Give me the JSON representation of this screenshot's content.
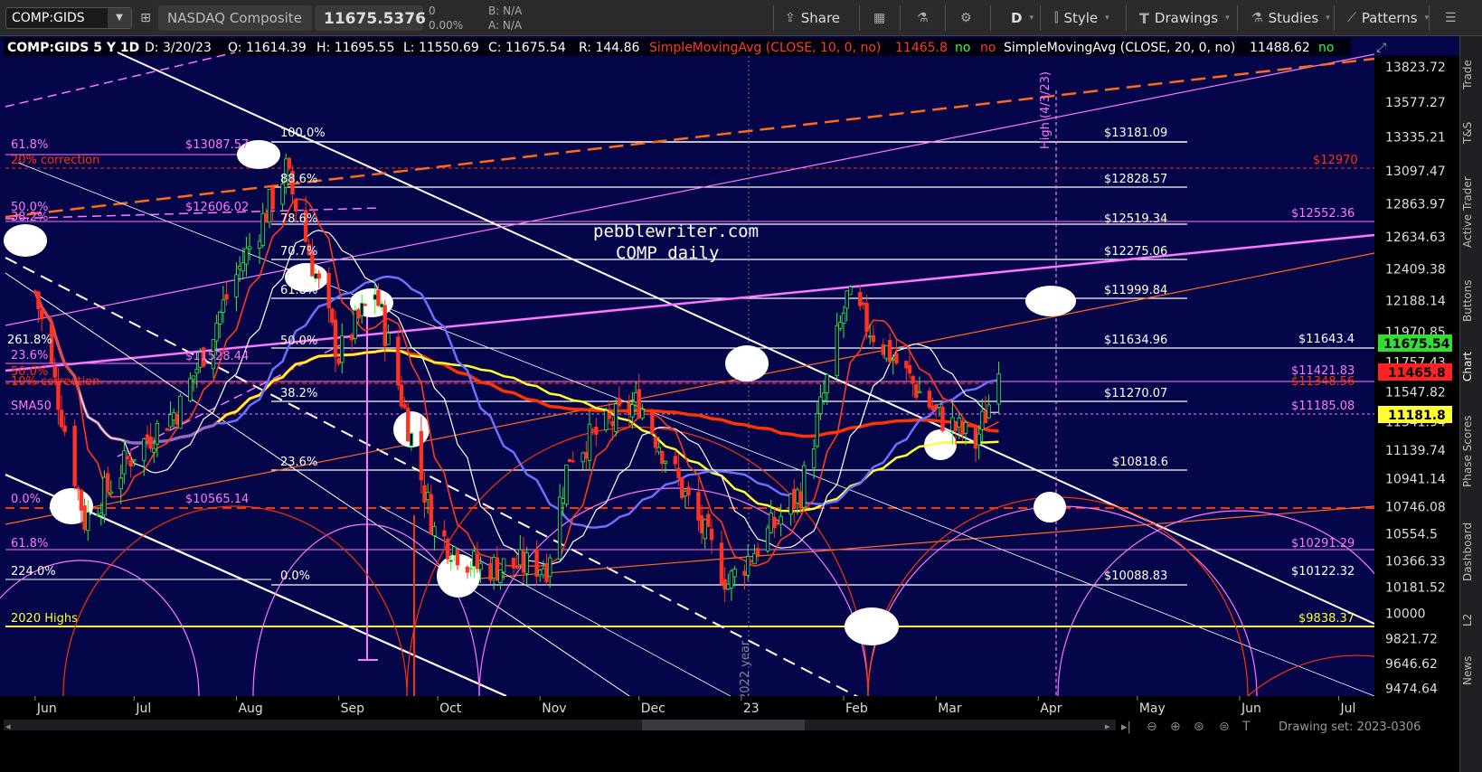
{
  "toolbar": {
    "symbol": "COMP:GIDS",
    "description": "NASDAQ Composite",
    "last_price": "11675.5376",
    "change": "0",
    "change_pct": "0.00%",
    "bid": "B: N/A",
    "ask": "A: N/A",
    "share_label": "Share",
    "period_label": "D",
    "style_label": "Style",
    "drawings_label": "Drawings",
    "studies_label": "Studies",
    "patterns_label": "Patterns"
  },
  "header": {
    "title": "COMP:GIDS 5 Y 1D",
    "date": "D: 3/20/23",
    "open": "O: 11614.39",
    "high": "H: 11695.55",
    "low": "L: 11550.69",
    "close": "C: 11675.54",
    "range": "R: 144.86",
    "sma10_label": "SimpleMovingAvg (CLOSE, 10, 0, no)",
    "sma10_value": "11465.8",
    "no1": "no",
    "no2": "no",
    "sma20_label": "SimpleMovingAvg (CLOSE, 20, 0, no)",
    "sma20_value": "11488.62",
    "no3": "no"
  },
  "watermark": {
    "line1": "pebblewriter.com",
    "line2": "COMP daily"
  },
  "annotations": {
    "high_marker": "High (4/3/23)",
    "year_marker": "2022 year",
    "left": [
      "61.8%",
      "20% correction",
      "50.0%",
      "38.2%",
      "261.8%",
      "23.6%",
      "50.0%",
      "10% correction",
      "SMA50",
      "0.0%",
      "61.8%",
      "224.0%",
      "2020 Highs"
    ],
    "fib_mid": [
      "100.0%",
      "88.6%",
      "78.6%",
      "70.7%",
      "61.8%",
      "50.0%",
      "38.2%",
      "23.6%",
      "0.0%"
    ],
    "pink_values": [
      "$13087.57",
      "$12606.02",
      "$11528.44",
      "$10565.14"
    ],
    "fib_values": [
      "$13181.09",
      "$12828.57",
      "$12519.34",
      "$12275.06",
      "$11999.84",
      "$11634.96",
      "$11270.07",
      "$10818.6",
      "$10088.83"
    ],
    "right_values": [
      "$12970",
      "$12552.36",
      "$11643.4",
      "$11421.83",
      "$11348.56",
      "$11185.08",
      "$10291.29",
      "$10122.32",
      "$9838.37"
    ]
  },
  "price_axis": {
    "ticks": [
      "13823.72",
      "13577.27",
      "13335.21",
      "13097.47",
      "12863.97",
      "12634.63",
      "12409.38",
      "12188.14",
      "11970.85",
      "11757.43",
      "11547.82",
      "11341.94",
      "11139.74",
      "10941.14",
      "10746.08",
      "10554.5",
      "10366.33",
      "10181.52",
      "10000",
      "9821.72",
      "9646.62",
      "9474.64"
    ],
    "last_label": "11675.54",
    "sma_label": "11465.8",
    "sma50_label": "11181.8"
  },
  "time_axis": {
    "ticks": [
      "Jun",
      "Jul",
      "Aug",
      "Sep",
      "Oct",
      "Nov",
      "Dec",
      "23",
      "Feb",
      "Mar",
      "Apr",
      "May",
      "Jun",
      "Jul"
    ]
  },
  "bottom": {
    "drawing_set": "Drawing set: 2023-0306"
  },
  "sidebar": {
    "tabs": [
      "Trade",
      "T&S",
      "Active Trader",
      "Buttons",
      "Chart",
      "Phase Scores",
      "Dashboard",
      "L2",
      "News"
    ]
  },
  "colors": {
    "chart_bg": "#05054a",
    "sma10": "#ff3a1a",
    "sma20": "#ffffff",
    "sma50": "#ffff33",
    "sma100": "#6e6eff",
    "sma200": "#ff3300",
    "pink": "#ff77ff",
    "orange": "#ff6a1a"
  },
  "chart_data": {
    "type": "candlestick",
    "title": "COMP:GIDS 5 Y 1D",
    "ylim": [
      9420,
      13900
    ],
    "x_labels": [
      "Jun",
      "Jul",
      "Aug",
      "Sep",
      "Oct",
      "Nov",
      "Dec",
      "23",
      "Feb",
      "Mar",
      "Apr",
      "May",
      "Jun",
      "Jul"
    ],
    "sampled_closes": [
      {
        "date": "2022-06-01",
        "close": 12250
      },
      {
        "date": "2022-06-16",
        "close": 10650
      },
      {
        "date": "2022-07-01",
        "close": 11130
      },
      {
        "date": "2022-07-15",
        "close": 11450
      },
      {
        "date": "2022-08-01",
        "close": 12370
      },
      {
        "date": "2022-08-16",
        "close": 13100
      },
      {
        "date": "2022-09-01",
        "close": 11800
      },
      {
        "date": "2022-09-12",
        "close": 12260
      },
      {
        "date": "2022-09-30",
        "close": 10575
      },
      {
        "date": "2022-10-13",
        "close": 10320
      },
      {
        "date": "2022-11-03",
        "close": 10340
      },
      {
        "date": "2022-11-10",
        "close": 11110
      },
      {
        "date": "2022-12-01",
        "close": 11480
      },
      {
        "date": "2022-12-28",
        "close": 10210
      },
      {
        "date": "2023-01-19",
        "close": 10850
      },
      {
        "date": "2023-02-02",
        "close": 12200
      },
      {
        "date": "2023-03-01",
        "close": 11400
      },
      {
        "date": "2023-03-13",
        "close": 11190
      },
      {
        "date": "2023-03-20",
        "close": 11675.54
      }
    ],
    "studies": [
      {
        "name": "SimpleMovingAvg (CLOSE, 10, 0, no)",
        "last": 11465.8
      },
      {
        "name": "SimpleMovingAvg (CLOSE, 20, 0, no)",
        "last": 11488.62
      }
    ]
  }
}
